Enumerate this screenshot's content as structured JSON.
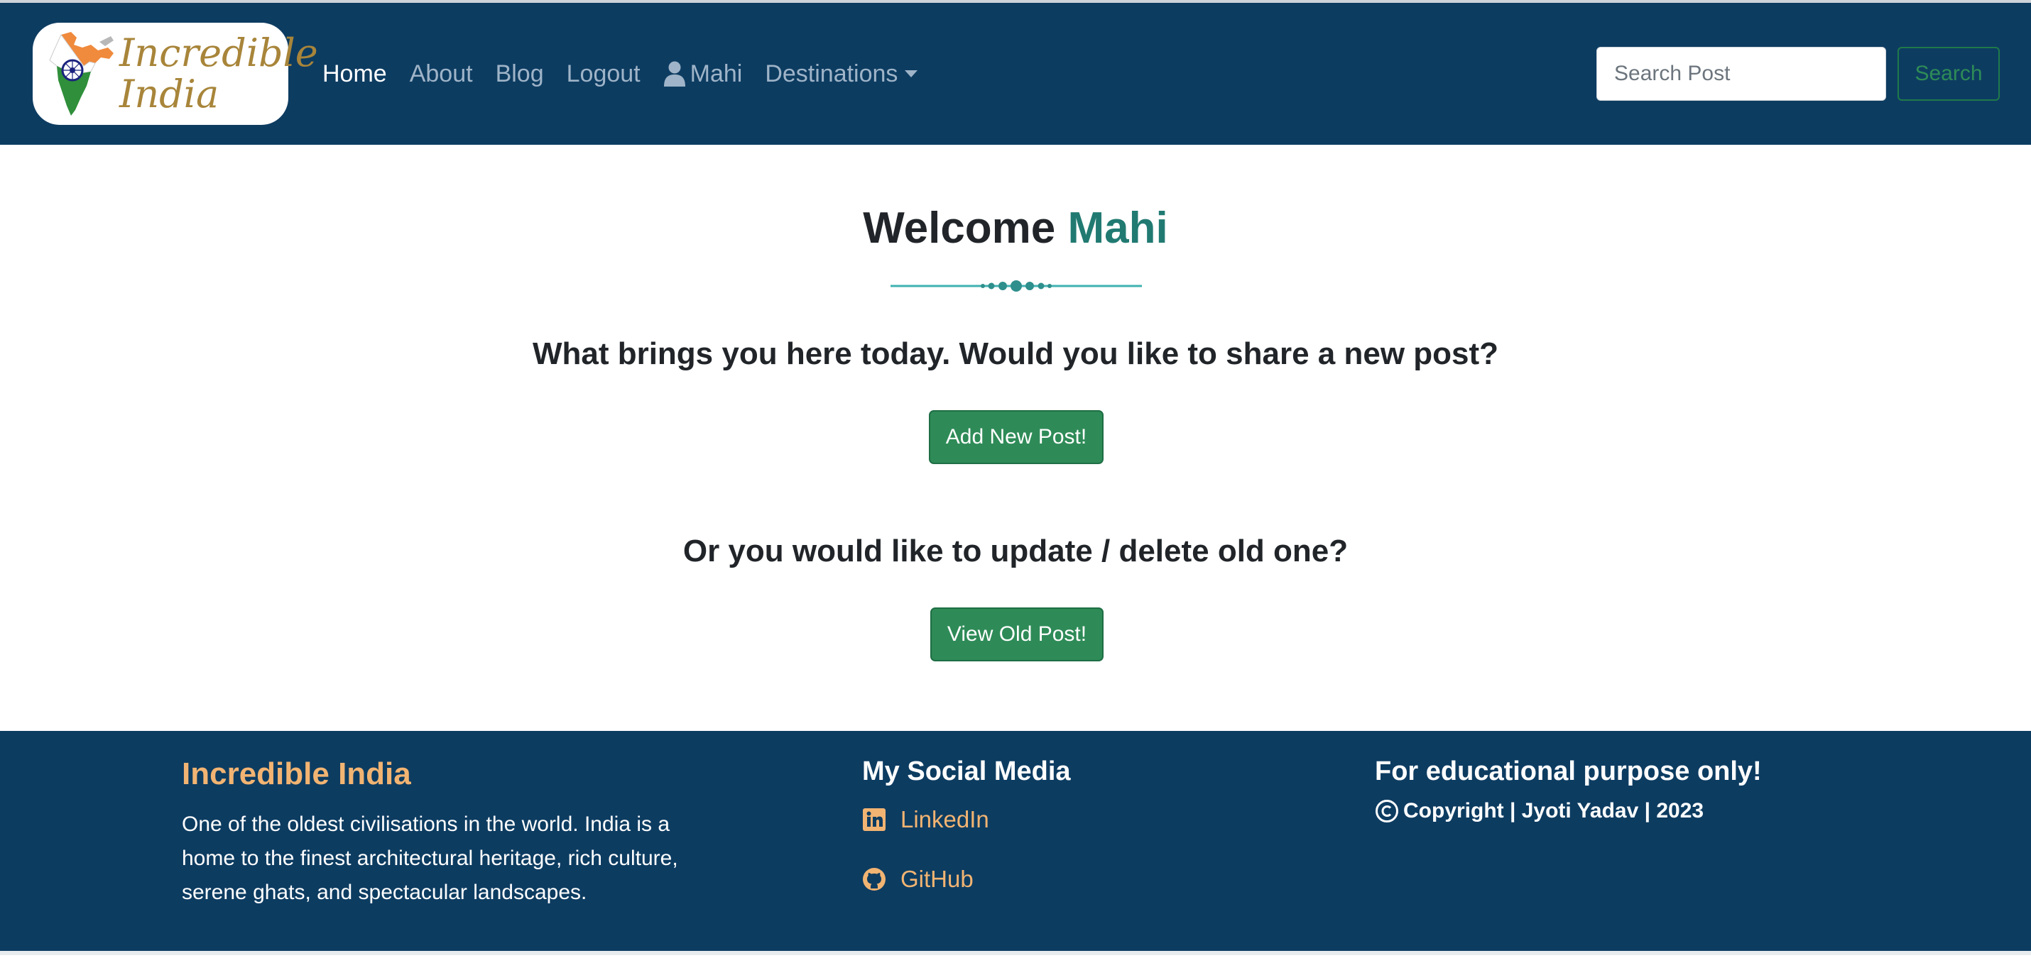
{
  "brand": {
    "logo_line1": "Incredible",
    "logo_line2": "India"
  },
  "nav": {
    "items": [
      {
        "label": "Home",
        "active": true
      },
      {
        "label": "About"
      },
      {
        "label": "Blog"
      },
      {
        "label": "Logout"
      },
      {
        "label": "Mahi",
        "icon": "user-icon"
      },
      {
        "label": "Destinations",
        "icon": "caret-down-icon"
      }
    ]
  },
  "search": {
    "placeholder": "Search Post",
    "button_label": "Search"
  },
  "main": {
    "welcome_prefix": "Welcome",
    "welcome_name": "Mahi",
    "question_new": "What brings you here today. Would you like to share a new post?",
    "add_button": "Add New Post!",
    "question_old": "Or you would like to update / delete old one?",
    "view_button": "View Old Post!"
  },
  "footer": {
    "brand": "Incredible India",
    "description": "One of the oldest civilisations in the world. India is a home to the finest architectural heritage, rich culture, serene ghats, and spectacular landscapes.",
    "social_title": "My Social Media",
    "linkedin": "LinkedIn",
    "github": "GitHub",
    "edu_note": "For educational purpose only!",
    "copyright": "Copyright | Jyoti Yadav | 2023"
  },
  "colors": {
    "navbar_bg": "#0d3c61",
    "accent_teal": "#217a72",
    "button_green": "#2e8b57",
    "footer_accent": "#f2b472"
  }
}
